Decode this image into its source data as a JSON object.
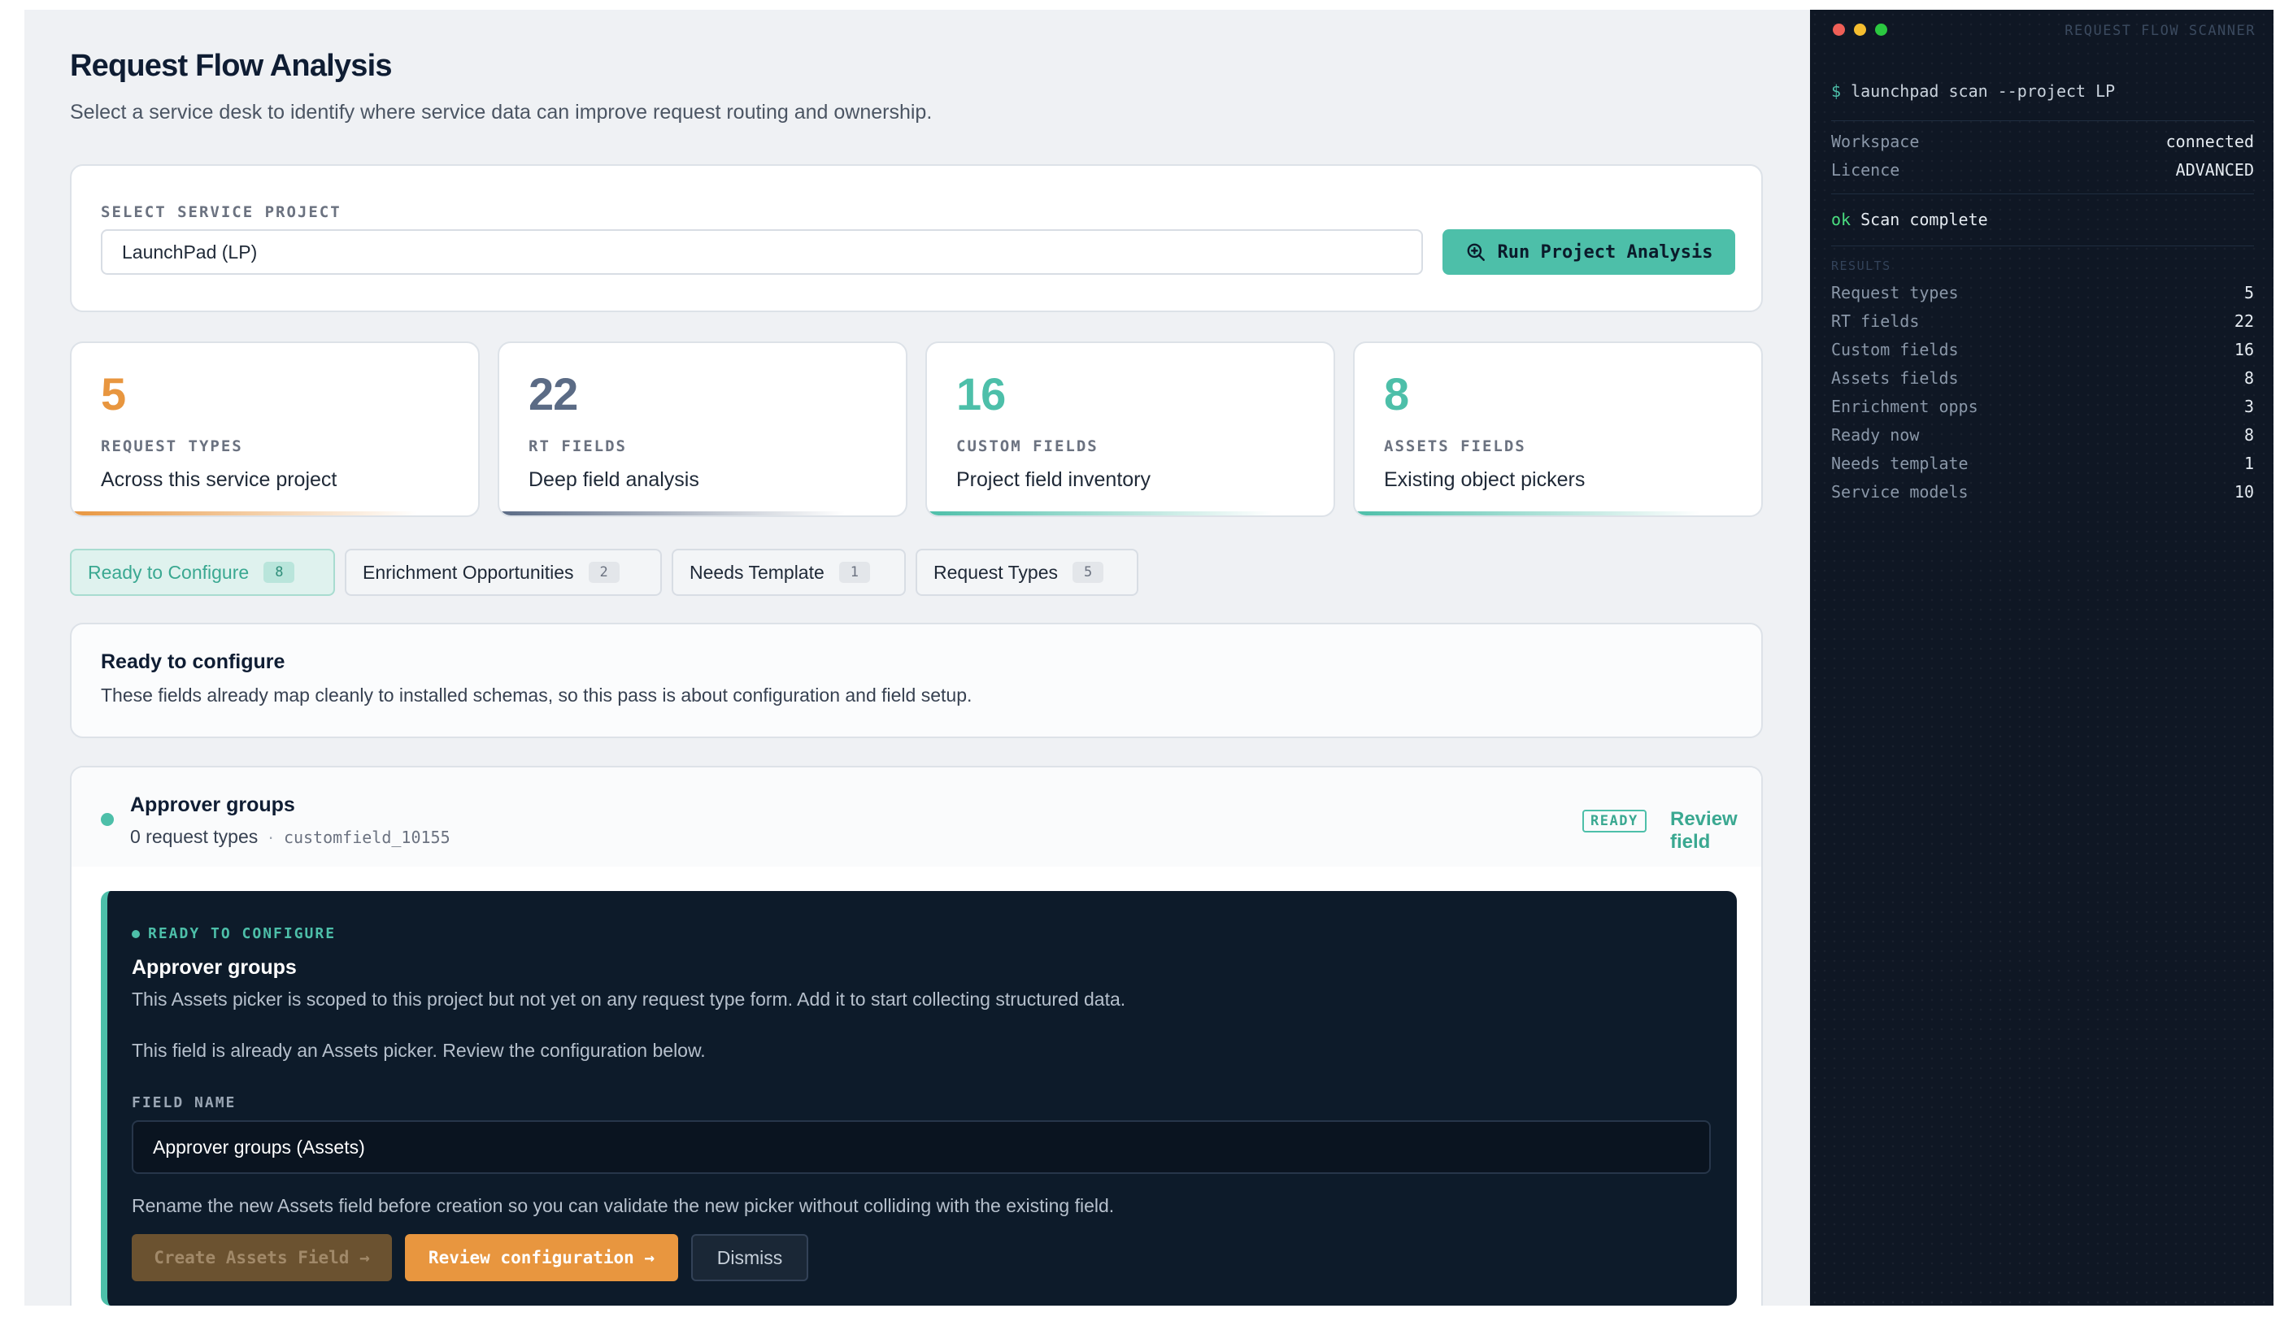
{
  "header": {
    "title": "Request Flow Analysis",
    "subtitle": "Select a service desk to identify where service data can improve request routing and ownership."
  },
  "selector": {
    "label": "SELECT SERVICE PROJECT",
    "value": "LaunchPad (LP)",
    "run_button": "Run Project Analysis",
    "run_icon": "search-zoom-icon"
  },
  "stats": [
    {
      "value": "5",
      "label": "REQUEST TYPES",
      "desc": "Across this service project",
      "color": "#e8963f"
    },
    {
      "value": "22",
      "label": "RT FIELDS",
      "desc": "Deep field analysis",
      "color": "#5b6b85"
    },
    {
      "value": "16",
      "label": "CUSTOM FIELDS",
      "desc": "Project field inventory",
      "color": "#4dbfa9"
    },
    {
      "value": "8",
      "label": "ASSETS FIELDS",
      "desc": "Existing object pickers",
      "color": "#4dbfa9"
    }
  ],
  "tabs": [
    {
      "label": "Ready to Configure",
      "count": "8",
      "active": true
    },
    {
      "label": "Enrichment Opportunities",
      "count": "2"
    },
    {
      "label": "Needs Template",
      "count": "1"
    },
    {
      "label": "Request Types",
      "count": "5"
    }
  ],
  "info": {
    "heading": "Ready to configure",
    "text": "These fields already map cleanly to installed schemas, so this pass is about configuration and field setup."
  },
  "field": {
    "name": "Approver groups",
    "request_types": "0 request types",
    "separator": "·",
    "field_id": "customfield_10155",
    "badge": "READY",
    "review_link": "Review field",
    "status_color": "#4dbfa9",
    "panel": {
      "tag": "READY TO CONFIGURE",
      "title": "Approver groups",
      "text1": "This Assets picker is scoped to this project but not yet on any request type form. Add it to start collecting structured data.",
      "text2": "This field is already an Assets picker. Review the configuration below.",
      "field_name_label": "FIELD NAME",
      "field_name_value": "Approver groups (Assets)",
      "hint": "Rename the new Assets field before creation so you can validate the new picker without colliding with the existing field.",
      "create_button": "Create Assets Field →",
      "review_button": "Review configuration →",
      "dismiss_button": "Dismiss"
    }
  },
  "terminal": {
    "title": "REQUEST FLOW SCANNER",
    "prompt": "$",
    "command": "launchpad scan --project LP",
    "env": [
      {
        "key": "Workspace",
        "value": "connected"
      },
      {
        "key": "Licence",
        "value": "ADVANCED"
      }
    ],
    "status_ok": "ok",
    "status_text": "Scan complete",
    "results_label": "RESULTS",
    "results": [
      {
        "key": "Request types",
        "value": "5"
      },
      {
        "key": "RT fields",
        "value": "22"
      },
      {
        "key": "Custom fields",
        "value": "16"
      },
      {
        "key": "Assets fields",
        "value": "8"
      },
      {
        "key": "Enrichment opps",
        "value": "3"
      },
      {
        "key": "Ready now",
        "value": "8"
      },
      {
        "key": "Needs template",
        "value": "1"
      },
      {
        "key": "Service models",
        "value": "10"
      }
    ],
    "window_dots": [
      "#ef5f57",
      "#f5bd2f",
      "#2bc840"
    ]
  }
}
